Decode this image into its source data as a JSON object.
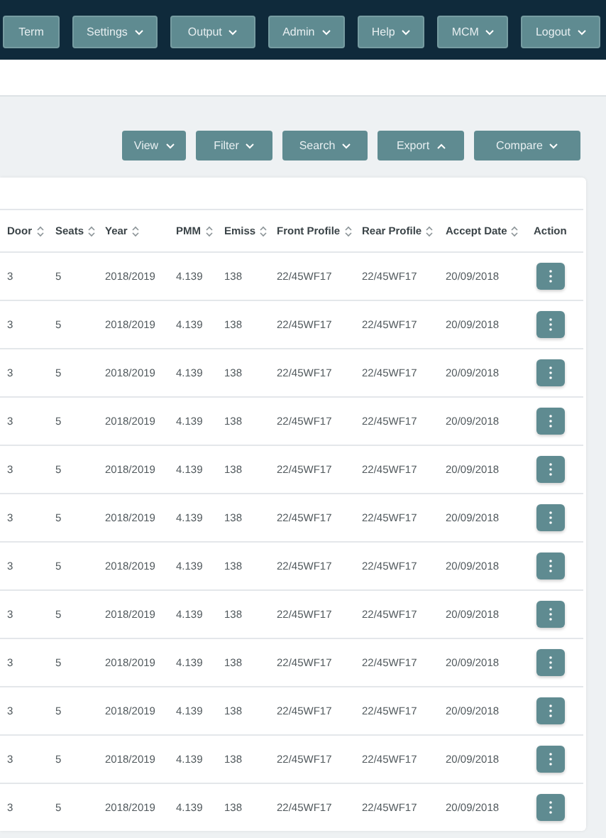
{
  "nav": {
    "items": [
      {
        "label": "Term",
        "dropdown": false
      },
      {
        "label": "Settings",
        "dropdown": true
      },
      {
        "label": "Output",
        "dropdown": true
      },
      {
        "label": "Admin",
        "dropdown": true
      },
      {
        "label": "Help",
        "dropdown": true
      },
      {
        "label": "MCM",
        "dropdown": true
      },
      {
        "label": "Logout",
        "dropdown": true
      }
    ]
  },
  "toolbar": {
    "buttons": [
      {
        "label": "View",
        "expanded": false
      },
      {
        "label": "Filter",
        "expanded": false
      },
      {
        "label": "Search",
        "expanded": false
      },
      {
        "label": "Export",
        "expanded": true
      },
      {
        "label": "Compare",
        "expanded": false
      }
    ]
  },
  "table": {
    "columns": [
      {
        "label": "Door",
        "sortable": true
      },
      {
        "label": "Seats",
        "sortable": true
      },
      {
        "label": "Year",
        "sortable": true
      },
      {
        "label": "PMM",
        "sortable": true
      },
      {
        "label": "Emiss",
        "sortable": true
      },
      {
        "label": "Front Profile",
        "sortable": true
      },
      {
        "label": "Rear Profile",
        "sortable": true
      },
      {
        "label": "Accept Date",
        "sortable": true
      },
      {
        "label": "Action",
        "sortable": false
      }
    ],
    "rows": [
      [
        "3",
        "5",
        "2018/2019",
        "4.139",
        "138",
        "22/45WF17",
        "22/45WF17",
        "20/09/2018"
      ],
      [
        "3",
        "5",
        "2018/2019",
        "4.139",
        "138",
        "22/45WF17",
        "22/45WF17",
        "20/09/2018"
      ],
      [
        "3",
        "5",
        "2018/2019",
        "4.139",
        "138",
        "22/45WF17",
        "22/45WF17",
        "20/09/2018"
      ],
      [
        "3",
        "5",
        "2018/2019",
        "4.139",
        "138",
        "22/45WF17",
        "22/45WF17",
        "20/09/2018"
      ],
      [
        "3",
        "5",
        "2018/2019",
        "4.139",
        "138",
        "22/45WF17",
        "22/45WF17",
        "20/09/2018"
      ],
      [
        "3",
        "5",
        "2018/2019",
        "4.139",
        "138",
        "22/45WF17",
        "22/45WF17",
        "20/09/2018"
      ],
      [
        "3",
        "5",
        "2018/2019",
        "4.139",
        "138",
        "22/45WF17",
        "22/45WF17",
        "20/09/2018"
      ],
      [
        "3",
        "5",
        "2018/2019",
        "4.139",
        "138",
        "22/45WF17",
        "22/45WF17",
        "20/09/2018"
      ],
      [
        "3",
        "5",
        "2018/2019",
        "4.139",
        "138",
        "22/45WF17",
        "22/45WF17",
        "20/09/2018"
      ],
      [
        "3",
        "5",
        "2018/2019",
        "4.139",
        "138",
        "22/45WF17",
        "22/45WF17",
        "20/09/2018"
      ],
      [
        "3",
        "5",
        "2018/2019",
        "4.139",
        "138",
        "22/45WF17",
        "22/45WF17",
        "20/09/2018"
      ],
      [
        "3",
        "5",
        "2018/2019",
        "4.139",
        "138",
        "22/45WF17",
        "22/45WF17",
        "20/09/2018"
      ]
    ]
  }
}
